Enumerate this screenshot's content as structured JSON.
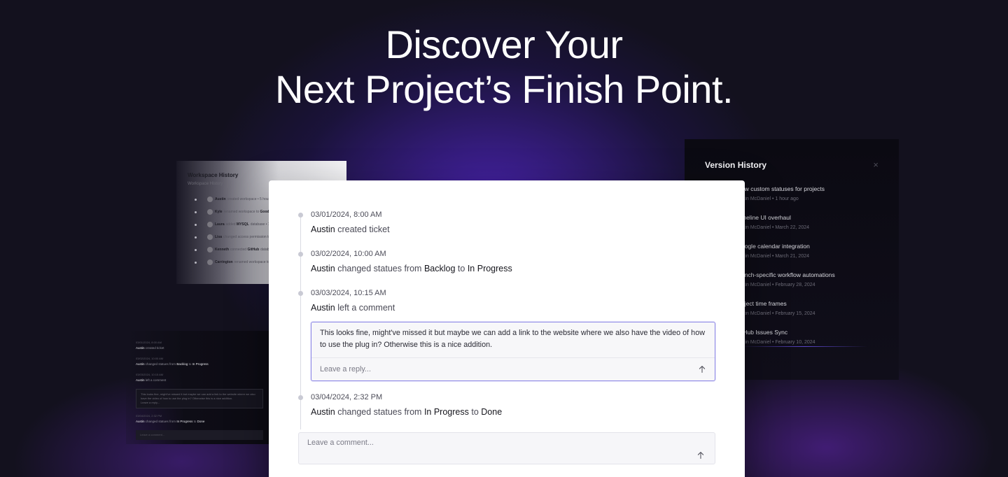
{
  "hero": {
    "line1": "Discover Your",
    "line2": "Next Project’s Finish Point."
  },
  "workspace_history": {
    "title": "Workspace History",
    "subtitle": "Workspace History",
    "items": [
      {
        "user": "Austin",
        "text": "created workspace • 5 hour"
      },
      {
        "user": "Kyle",
        "text": "renamed workspace to",
        "target": "Good"
      },
      {
        "user": "Laura",
        "text": "added",
        "target": "MYSQL",
        "extra": "database • 1"
      },
      {
        "user": "Lisa",
        "text": "changed access permission to"
      },
      {
        "user": "Kenneth",
        "text": "connected",
        "target": "GitHub",
        "extra": "datab"
      },
      {
        "user": "Carrington",
        "text": "renamed workspace to"
      }
    ]
  },
  "dark_activity": {
    "rows": [
      {
        "date": "03/01/2024, 8:00 AM",
        "user": "Austin",
        "text": "created ticket"
      },
      {
        "date": "03/02/2024, 10:00 AM",
        "user": "Austin",
        "text": "changed statues from",
        "from": "Backlog",
        "to_word": "to",
        "to": "In Progress"
      },
      {
        "date": "03/03/2024, 10:15 AM",
        "user": "Austin",
        "text": "left a comment"
      }
    ],
    "comment": "This looks fine, might've missed it but maybe we can add a link to the website where we also have the video of how to use the plug in? Otherwise this is a nice addition.",
    "reply_placeholder": "Leave a reply...",
    "last_row": {
      "date": "03/04/2024, 2:32 PM",
      "user": "Austin",
      "text": "changed statues from",
      "from": "In Progress",
      "to_word": "to",
      "to": "Done"
    },
    "input_placeholder": "Leave a comment..."
  },
  "version_history": {
    "title": "Version History",
    "close_glyph": "×",
    "items": [
      {
        "title": "ew custom statuses for projects",
        "meta": "stin McDaniel • 1 hour ago"
      },
      {
        "title": "meline UI overhaul",
        "meta": "stin McDaniel • March 22, 2024"
      },
      {
        "title": "oogle calendar integration",
        "meta": "stin McDaniel • March 21, 2024"
      },
      {
        "title": "anch-specific workflow automations",
        "meta": "stin McDaniel • February 28, 2024"
      },
      {
        "title": "oject time frames",
        "meta": "stin McDaniel • February 15, 2024"
      },
      {
        "title": "tHub Issues Sync",
        "meta": "stin McDaniel • February 10, 2024"
      }
    ]
  },
  "timeline": {
    "items": [
      {
        "date": "03/01/2024, 8:00 AM",
        "user": "Austin",
        "action": "created ticket"
      },
      {
        "date": "03/02/2024, 10:00 AM",
        "user": "Austin",
        "action": "changed statues from",
        "from": "Backlog",
        "to_word": "to",
        "to": "In Progress"
      },
      {
        "date": "03/03/2024, 10:15 AM",
        "user": "Austin",
        "action": "left a comment"
      },
      {
        "date": "03/04/2024, 2:32 PM",
        "user": "Austin",
        "action": "changed statues from",
        "from": "In Progress",
        "to_word": "to",
        "to": "Done"
      }
    ],
    "comment": {
      "text": "This looks fine, might've missed it but maybe we can add a link to the website where we also have the video of how to use the plug in? Otherwise this is a nice addition.",
      "reply_placeholder": "Leave a reply..."
    },
    "new_comment_placeholder": "Leave a comment...",
    "send_icon": "arrow-up-icon"
  },
  "colors": {
    "background": "#13111e",
    "glow": "#5226c8",
    "accent_border": "#8b86e6"
  }
}
